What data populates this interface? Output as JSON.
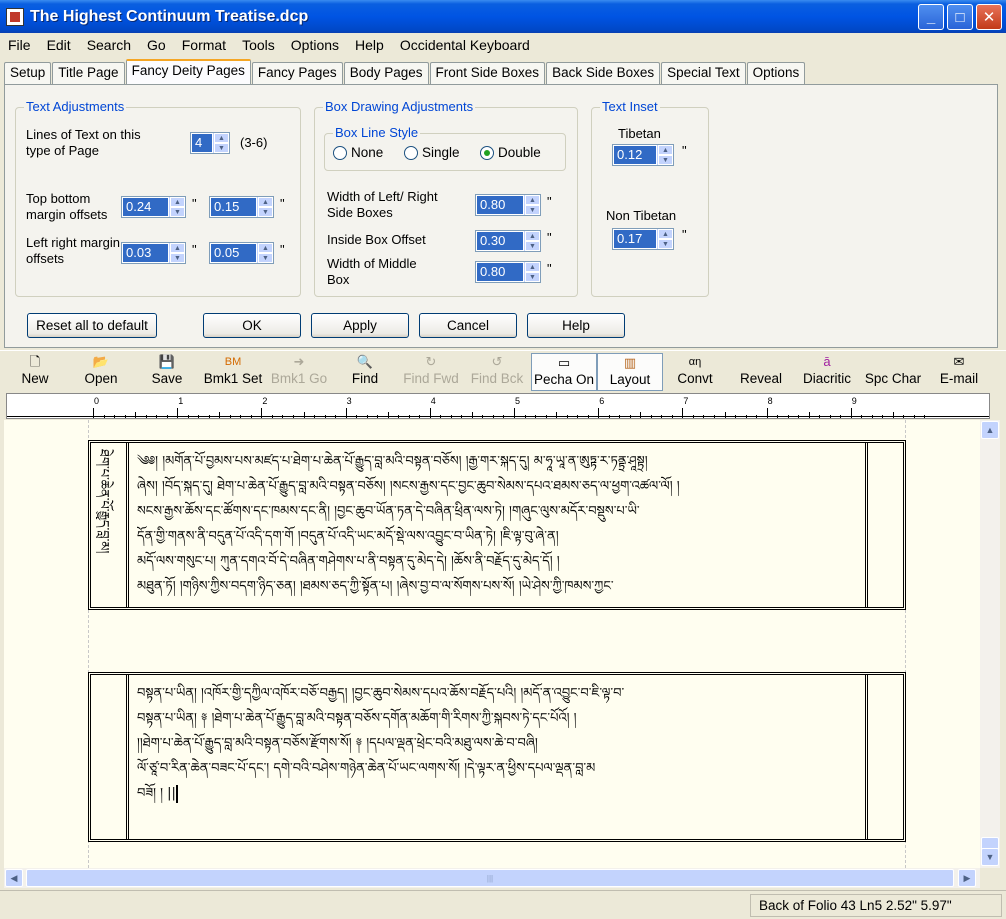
{
  "window": {
    "title": "The Highest Continuum Treatise.dcp",
    "minimize_glyph": "_",
    "maximize_glyph": "□",
    "close_glyph": "✕"
  },
  "menu": [
    "File",
    "Edit",
    "Search",
    "Go",
    "Format",
    "Tools",
    "Options",
    "Help",
    "Occidental Keyboard"
  ],
  "tabs": [
    "Setup",
    "Title Page",
    "Fancy Deity Pages",
    "Fancy Pages",
    "Body Pages",
    "Front Side Boxes",
    "Back Side Boxes",
    "Special Text",
    "Options"
  ],
  "active_tab": "Fancy Deity Pages",
  "text_adjustments": {
    "label": "Text Adjustments",
    "lines_label": "Lines of Text on this type of Page",
    "lines_value": "4",
    "lines_range": "(3-6)",
    "top_bottom_label": "Top bottom margin offsets",
    "top_value": "0.24",
    "bottom_value": "0.15",
    "left_right_label": "Left right margin offsets",
    "left_value": "0.03",
    "right_value": "0.05",
    "inch": "\""
  },
  "box_drawing": {
    "label": "Box Drawing Adjustments",
    "line_style_label": "Box Line Style",
    "options": [
      "None",
      "Single",
      "Double"
    ],
    "selected": "Double",
    "side_width_label": "Width of Left/ Right Side Boxes",
    "side_width_value": "0.80",
    "inside_offset_label": "Inside Box Offset",
    "inside_offset_value": "0.30",
    "middle_width_label": "Width of Middle Box",
    "middle_width_value": "0.80"
  },
  "text_inset": {
    "label": "Text Inset",
    "tibetan_label": "Tibetan",
    "tibetan_value": "0.12",
    "non_tibetan_label": "Non Tibetan",
    "non_tibetan_value": "0.17"
  },
  "buttons": {
    "reset": "Reset all to default",
    "ok": "OK",
    "apply": "Apply",
    "cancel": "Cancel",
    "help": "Help"
  },
  "toolbar": [
    {
      "label": "New",
      "icon": "new-file-icon",
      "glyph": "🗋",
      "enabled": true
    },
    {
      "label": "Open",
      "icon": "open-folder-icon",
      "glyph": "📂",
      "enabled": true
    },
    {
      "label": "Save",
      "icon": "save-disk-icon",
      "glyph": "💾",
      "enabled": true
    },
    {
      "label": "Bmk1 Set",
      "icon": "bookmark-set-icon",
      "glyph": "BM",
      "enabled": true
    },
    {
      "label": "Bmk1 Go",
      "icon": "bookmark-go-icon",
      "glyph": "➜",
      "enabled": false
    },
    {
      "label": "Find",
      "icon": "find-magnifier-icon",
      "glyph": "🔍",
      "enabled": true
    },
    {
      "label": "Find Fwd",
      "icon": "find-forward-icon",
      "glyph": "↻",
      "enabled": false
    },
    {
      "label": "Find Bck",
      "icon": "find-back-icon",
      "glyph": "↺",
      "enabled": false
    },
    {
      "label": "Pecha On",
      "icon": "pecha-icon",
      "glyph": "▭",
      "enabled": true,
      "pressed": true
    },
    {
      "label": "Layout",
      "icon": "layout-icon",
      "glyph": "▥",
      "enabled": true,
      "pressed": true
    },
    {
      "label": "Convt",
      "icon": "convert-icon",
      "glyph": "αη",
      "enabled": true
    },
    {
      "label": "Reveal",
      "icon": "reveal-icon",
      "glyph": "",
      "enabled": true
    },
    {
      "label": "Diacritic",
      "icon": "diacritic-icon",
      "glyph": "ā",
      "enabled": true
    },
    {
      "label": "Spc Char",
      "icon": "special-char-icon",
      "glyph": "",
      "enabled": true
    },
    {
      "label": "E-mail",
      "icon": "email-envelope-icon",
      "glyph": "✉",
      "enabled": true
    }
  ],
  "ruler": {
    "numbers": [
      "0",
      "1",
      "2",
      "3",
      "4",
      "5",
      "6",
      "7",
      "8",
      "9"
    ]
  },
  "page1": {
    "side_text": "ཐེག་པ་ཆེན་པོ་རྒྱུད་བླ་མ།",
    "lines": [
      "༄༅། །མགོན་པོ་བྱམས་པས་མཛད་པ་ཐེག་པ་ཆེན་པོ་རྒྱུད་བླ་མའི་བསྟན་བཅོས། །རྒྱ་གར་སྐད་དུ། མ་ཧཱ་ཡཱ་ན་ཨུཏྟ་ར་ཏནྟྲ་ཤཱསྟྲ།",
      "ཞེས། །བོད་སྐད་དུ། ཐེག་པ་ཆེན་པོ་རྒྱུད་བླ་མའི་བསྟན་བཅོས། །སངས་རྒྱས་དང་བྱང་ཆུབ་སེམས་དཔའ་ཐམས་ཅད་ལ་ཕྱག་འཚལ་ལོ། །",
      "སངས་རྒྱས་ཆོས་དང་ཚོགས་དང་ཁམས་དང་ནི། །བྱང་ཆུབ་ཡོན་ཏན་དེ་བཞིན་ཕྲིན་ལས་ཏེ། །གཞུང་ལུས་མདོར་བསྡུས་པ་ཡི་",
      "དོན་གྱི་གནས་ནི་བདུན་པོ་འདི་དག་གོ །བདུན་པོ་འདི་ཡང་མདོ་སྡེ་ལས་འབྱུང་བ་ཡིན་ཏེ། །ཇི་ལྟ་བུ་ཞེ་ན།",
      "མདོ་ལས་གསུང་པ། ཀུན་དགའ་བོ་དེ་བཞིན་གཤེགས་པ་ནི་བསྟན་དུ་མེད་དེ། །ཆོས་ནི་བརྗོད་དུ་མེད་དོ། །",
      "མཐུན་ཏོ། །གཉིས་ཀྱིས་བདག་ཉིད་ཅན། །ཐམས་ཅད་ཀྱི་སྟོན་པ། །ཞེས་བྱ་བ་ལ་སོགས་པས་སོ། །ཡེ་ཤེས་ཀྱི་ཁམས་ཀྱང་"
    ]
  },
  "page2": {
    "lines": [
      "བསྟན་པ་ཡིན། །འཁོར་གྱི་དཀྱིལ་འཁོར་བཅོ་བརྒྱད། །བྱང་ཆུབ་སེམས་དཔའ་ཆོས་བརྗོད་པའི། །མདོ་ན་འབྱུང་བ་ཇི་ལྟ་བ་",
      "བསྟན་པ་ཡིན། ༈ །ཐེག་པ་ཆེན་པོ་རྒྱུད་བླ་མའི་བསྟན་བཅོས་དགོན་མཆོག་གི་རིགས་ཀྱི་སྐབས་ཏེ་དང་པོའོ། །",
      "།།ཐེག་པ་ཆེན་པོ་རྒྱུད་བླ་མའི་བསྟན་བཅོས་རྫོགས་སོ། ༈ །དཔལ་ལྡན་ཕྲེང་བའི་མཐུ་ལས་ཆེ་བ་བཞི།",
      "ལོ་ཙཱ་བ་རིན་ཆེན་བཟང་པོ་དང་། དགེ་བའི་བཤེས་གཉེན་ཆེན་པོ་ཡང་ལགས་སོ། །དེ་ལྟར་ན་ཕྱིས་དཔལ་ལྡན་བླ་མ",
      "བཟོ། ། ||"
    ]
  },
  "status": "Back of Folio 43 Ln5 2.52\" 5.97\""
}
